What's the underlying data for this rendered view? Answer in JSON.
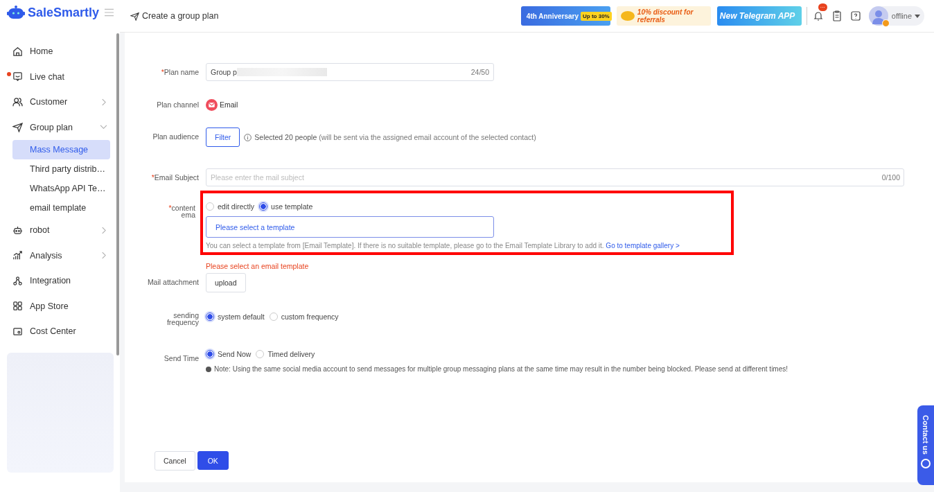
{
  "brand": {
    "name": "SaleSmartly"
  },
  "header": {
    "title": "Create a group plan",
    "banners": [
      {
        "kind": "anniversary",
        "text": "4th Anniversary",
        "badge": "Up to 30%"
      },
      {
        "kind": "discount",
        "text": "10% discount for referrals"
      },
      {
        "kind": "telegram",
        "text": "New Telegram APP"
      }
    ],
    "notification_badge": "···",
    "status": "offline"
  },
  "sidebar": {
    "items": [
      {
        "label": "Home",
        "selected": false
      },
      {
        "label": "Live chat",
        "selected": false,
        "dot": true
      },
      {
        "label": "Customer",
        "selected": false,
        "expanded": false
      },
      {
        "label": "Group plan",
        "selected": false,
        "expanded": true,
        "children": [
          {
            "label": "Mass Message",
            "selected": true
          },
          {
            "label": "Third party distrib…",
            "selected": false
          },
          {
            "label": "WhatsApp API Te…",
            "selected": false
          },
          {
            "label": "email template",
            "selected": false
          }
        ]
      },
      {
        "label": "robot",
        "selected": false,
        "expanded": false
      },
      {
        "label": "Analysis",
        "selected": false,
        "expanded": false
      },
      {
        "label": "Integration",
        "selected": false
      },
      {
        "label": "App Store",
        "selected": false
      },
      {
        "label": "Cost Center",
        "selected": false
      }
    ]
  },
  "form": {
    "plan_name": {
      "label": "Plan name",
      "required_mark": "*",
      "value": "Group p",
      "counter": "24/50"
    },
    "plan_channel": {
      "label": "Plan channel",
      "value": "Email"
    },
    "plan_audience": {
      "label": "Plan audience",
      "button": "Filter",
      "selected": "Selected 20 people",
      "note": "(will be sent via the assigned email account of the selected contact)"
    },
    "email_subject": {
      "label": "Email Subject",
      "required_mark": "*",
      "placeholder": "Please enter the mail subject",
      "counter": "0/100"
    },
    "content": {
      "label_lines": [
        "content",
        "ema"
      ],
      "required_mark": "*",
      "options": [
        {
          "label": "edit directly",
          "selected": false
        },
        {
          "label": "use template",
          "selected": true
        }
      ],
      "template_placeholder": "Please select a template",
      "help": "You can select a template from [Email Template]. If there is no suitable template, please go to the Email Template Library to add it.",
      "link": "Go to template gallery >",
      "error": "Please select an email template"
    },
    "attachment": {
      "label": "Mail attachment",
      "button": "upload"
    },
    "frequency": {
      "label_lines": [
        "sending",
        "frequency"
      ],
      "options": [
        {
          "label": "system default",
          "selected": true
        },
        {
          "label": "custom frequency",
          "selected": false
        }
      ]
    },
    "send_time": {
      "label": "Send Time",
      "options": [
        {
          "label": "Send Now",
          "selected": true
        },
        {
          "label": "Timed delivery",
          "selected": false
        }
      ],
      "note": "Note: Using the same social media account to send messages for multiple group messaging plans at the same time may result in the number being blocked. Please send at different times!"
    },
    "buttons": {
      "cancel": "Cancel",
      "ok": "OK"
    }
  },
  "contact": {
    "label": "Contact us"
  }
}
